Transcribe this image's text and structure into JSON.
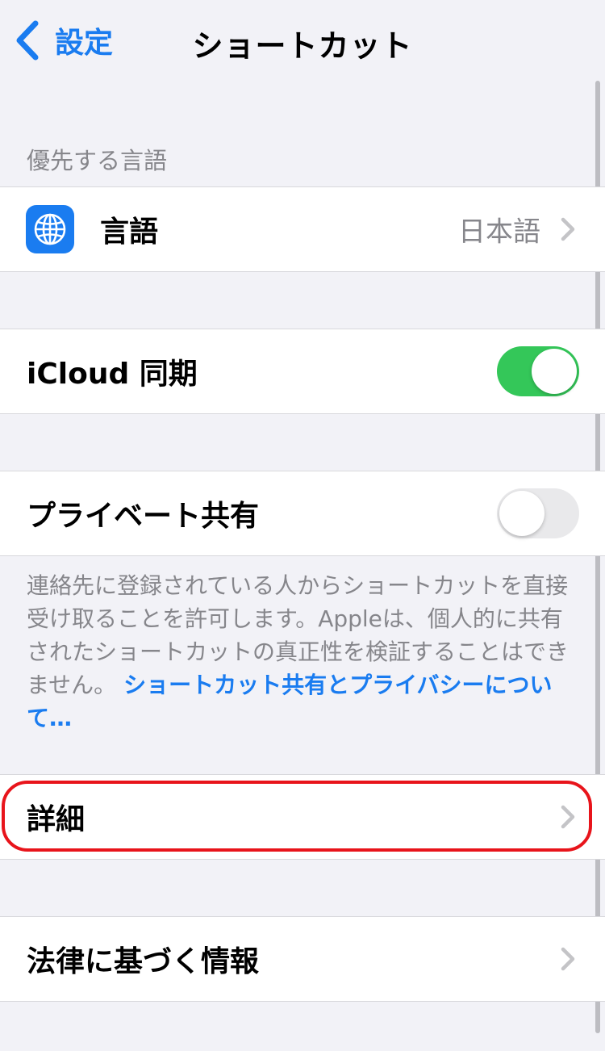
{
  "navbar": {
    "back_label": "設定",
    "title": "ショートカット"
  },
  "language_section": {
    "header": "優先する言語",
    "row": {
      "icon": "globe-icon",
      "label": "言語",
      "value": "日本語"
    }
  },
  "icloud_sync": {
    "label": "iCloud 同期",
    "enabled": true
  },
  "private_sharing": {
    "label": "プライベート共有",
    "enabled": false,
    "footnote": "連絡先に登録されている人からショートカットを直接受け取ることを許可します。Appleは、個人的に共有されたショートカットの真正性を検証することはできません。",
    "footnote_link": "ショートカット共有とプライバシーについて…"
  },
  "advanced": {
    "label": "詳細"
  },
  "legal": {
    "label": "法律に基づく情報"
  },
  "colors": {
    "accent": "#1a7cf0",
    "toggle_on": "#34c759",
    "highlight": "#e8141b",
    "background": "#f2f2f7"
  }
}
